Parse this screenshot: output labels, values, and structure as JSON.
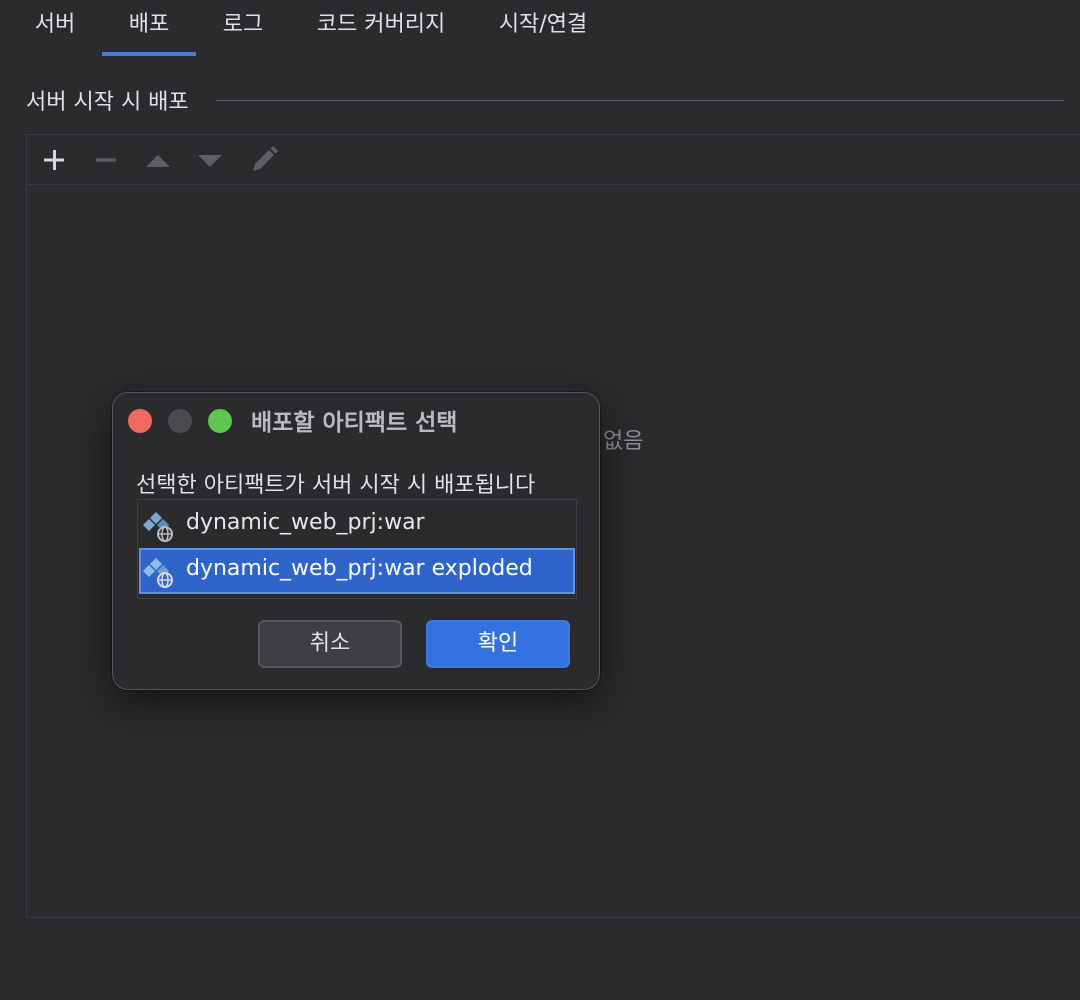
{
  "tabs": [
    {
      "label": "서버"
    },
    {
      "label": "배포"
    },
    {
      "label": "로그"
    },
    {
      "label": "코드 커버리지"
    },
    {
      "label": "시작/연결"
    }
  ],
  "section": {
    "title": "서버 시작 시 배포"
  },
  "toolbar": {
    "icons": [
      "add-icon",
      "remove-icon",
      "move-up-icon",
      "move-down-icon",
      "edit-icon"
    ]
  },
  "panel": {
    "empty_text_fragment": "없음"
  },
  "dialog": {
    "title": "배포할 아티팩트 선택",
    "description": "선택한 아티팩트가 서버 시작 시 배포됩니다",
    "artifacts": [
      {
        "label": "dynamic_web_prj:war",
        "selected": false,
        "icon": "web-artifact-icon"
      },
      {
        "label": "dynamic_web_prj:war exploded",
        "selected": true,
        "icon": "web-artifact-icon"
      }
    ],
    "cancel_label": "취소",
    "ok_label": "확인"
  },
  "colors": {
    "background": "#2b2b2d",
    "accent": "#3473df",
    "selection": "#2f65ca",
    "tab_underline": "#4a7bd0"
  }
}
